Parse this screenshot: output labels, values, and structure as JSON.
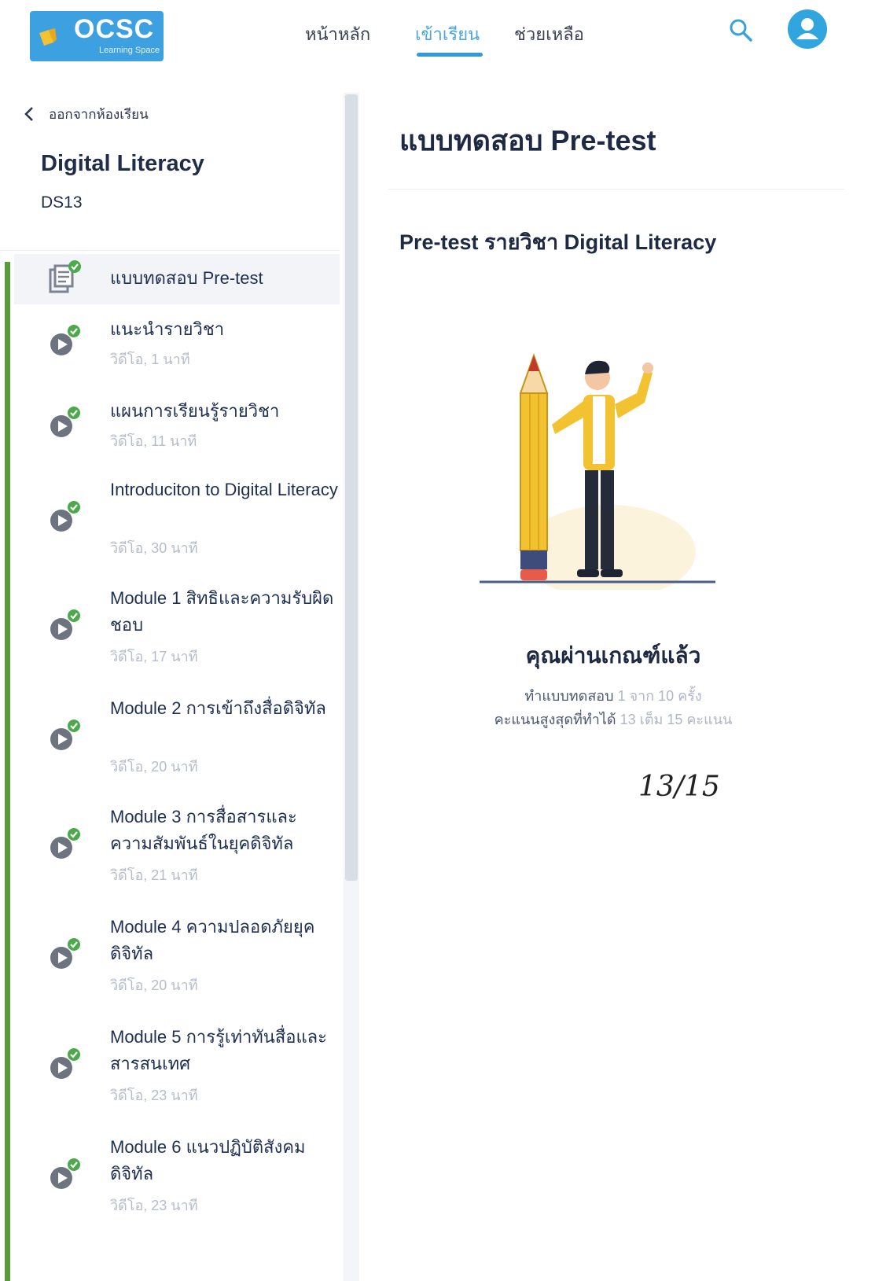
{
  "header": {
    "logo_text": "OCSC",
    "logo_subtext": "Learning Space",
    "nav": [
      {
        "label": "หน้าหลัก"
      },
      {
        "label": "เข้าเรียน"
      },
      {
        "label": "ช่วยเหลือ"
      }
    ],
    "brand_color": "#3da0e0",
    "accent_color": "#2f9ae0"
  },
  "sidebar": {
    "back_label": "ออกจากห้องเรียน",
    "course_title": "Digital Literacy",
    "course_code": "DS13",
    "progress_color": "#5b9a3c",
    "lessons": [
      {
        "title": "แบบทดสอบ Pre-test",
        "meta": "",
        "icon": "quiz-document-icon",
        "completed": true
      },
      {
        "title": "แนะนำรายวิชา",
        "meta": "วิดีโอ, 1 นาที",
        "icon": "video-play-icon",
        "completed": true
      },
      {
        "title": "แผนการเรียนรู้รายวิชา",
        "meta": "วิดีโอ, 11 นาที",
        "icon": "video-play-icon",
        "completed": true
      },
      {
        "title": "Introduciton to Digital Literacy",
        "meta": "วิดีโอ, 30 นาที",
        "icon": "video-play-icon",
        "completed": true
      },
      {
        "title": "Module 1 สิทธิและความรับผิดชอบ",
        "meta": "วิดีโอ, 17 นาที",
        "icon": "video-play-icon",
        "completed": true
      },
      {
        "title": "Module 2 การเข้าถึงสื่อดิจิทัล",
        "meta": "วิดีโอ, 20 นาที",
        "icon": "video-play-icon",
        "completed": true
      },
      {
        "title": "Module 3 การสื่อสารและความสัมพันธ์ในยุคดิจิทัล",
        "meta": "วิดีโอ, 21 นาที",
        "icon": "video-play-icon",
        "completed": true
      },
      {
        "title": "Module 4 ความปลอดภัยยุคดิจิทัล",
        "meta": "วิดีโอ, 20 นาที",
        "icon": "video-play-icon",
        "completed": true
      },
      {
        "title": "Module 5 การรู้เท่าทันสื่อและสารสนเทศ",
        "meta": "วิดีโอ, 23 นาที",
        "icon": "video-play-icon",
        "completed": true
      },
      {
        "title": "Module 6 แนวปฏิบัติสังคมดิจิทัล",
        "meta": "วิดีโอ, 23 นาที",
        "icon": "video-play-icon",
        "completed": true
      }
    ]
  },
  "main": {
    "page_title": "แบบทดสอบ Pre-test",
    "quiz_title": "Pre-test รายวิชา Digital Literacy",
    "result_title": "คุณผ่านเกณฑ์แล้ว",
    "attempts_label": "ทำแบบทดสอบ",
    "attempts_value": "1 จาก 10 ครั้ง",
    "score_label": "คะแนนสูงสุดที่ทำได้",
    "score_value": "13 เต็ม 15 คะแนน",
    "handwritten_note": "13/15"
  }
}
